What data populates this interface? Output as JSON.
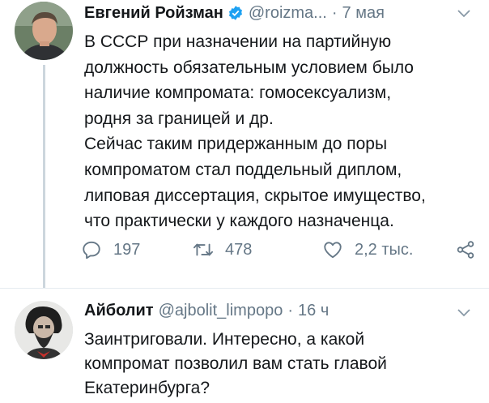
{
  "tweet1": {
    "name": "Евгений Ройзман",
    "handle": "@roizma...",
    "dot": "·",
    "time": "7 мая",
    "text": "В СССР при назначении на партийную\nдолжность обязательным условием было\nналичие компромата: гомосексуализм,\nродня за границей и др.\nСейчас таким придержанным до поры\nкомпроматом стал поддельный диплом,\nлиповая диссертация, скрытое имущество,\nчто практически у каждого назначенца.",
    "replies": "197",
    "retweets": "478",
    "likes": "2,2 тыс."
  },
  "tweet2": {
    "name": "Айболит",
    "handle": "@ajbolit_limpopo",
    "dot": "·",
    "time": "16 ч",
    "text": "Заинтриговали. Интересно, а какой\nкомпромат позволил вам стать главой\nЕкатеринбурга?"
  },
  "icons": {
    "verified": "verified-badge-icon",
    "caret": "chevron-down-icon",
    "reply": "reply-icon",
    "retweet": "retweet-icon",
    "like": "heart-icon",
    "share": "share-icon"
  },
  "colors": {
    "accent": "#1da1f2",
    "secondary_text": "#657786",
    "thread_line": "#ccd6dd"
  }
}
